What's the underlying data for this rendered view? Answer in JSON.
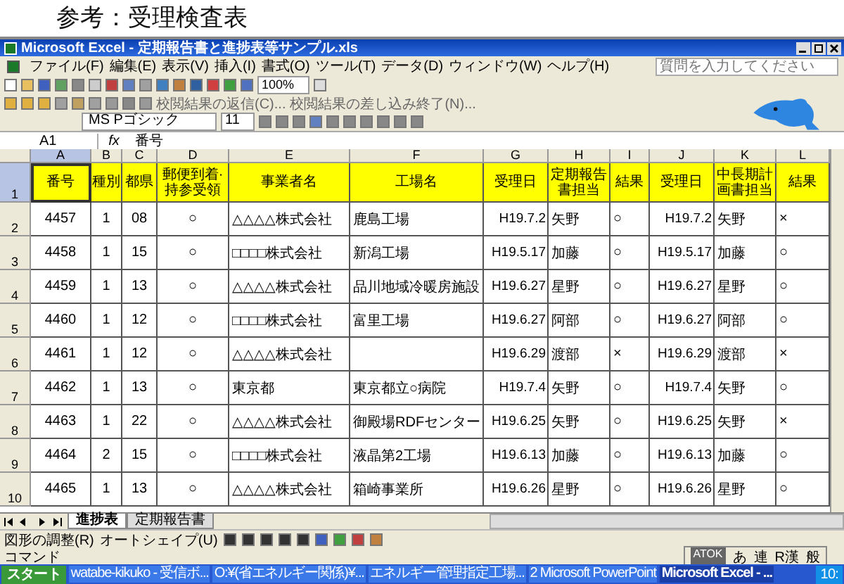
{
  "slide_title": "参考：受理検査表",
  "window": {
    "title": "Microsoft Excel - 定期報告書と進捗表等サンプル.xls"
  },
  "menu": [
    "ファイル(F)",
    "編集(E)",
    "表示(V)",
    "挿入(I)",
    "書式(O)",
    "ツール(T)",
    "データ(D)",
    "ウィンドウ(W)",
    "ヘルプ(H)"
  ],
  "help_search": {
    "placeholder": "質問を入力してください"
  },
  "standard_toolbar": {
    "zoom": "100%"
  },
  "review_toolbar": [
    "校閲結果の返信(C)...",
    "校閲結果の差し込み終了(N)..."
  ],
  "format_toolbar": {
    "font": "MS Pゴシック",
    "size": "11"
  },
  "formula_bar": {
    "name_box": "A1",
    "fx": "fx",
    "value": "番号"
  },
  "columns": [
    {
      "label": "A",
      "selected": true
    },
    {
      "label": "B",
      "selected": false
    },
    {
      "label": "C",
      "selected": false
    },
    {
      "label": "D",
      "selected": false
    },
    {
      "label": "E",
      "selected": false
    },
    {
      "label": "F",
      "selected": false
    },
    {
      "label": "G",
      "selected": false
    },
    {
      "label": "H",
      "selected": false
    },
    {
      "label": "I",
      "selected": false
    },
    {
      "label": "J",
      "selected": false
    },
    {
      "label": "K",
      "selected": false
    },
    {
      "label": "L",
      "selected": false
    }
  ],
  "header_row": {
    "row": "1",
    "selected": true,
    "cells": [
      "番号",
      "種別",
      "都県",
      "郵便到着·持参受領",
      "事業者名",
      "工場名",
      "受理日",
      "定期報告書担当",
      "結果",
      "受理日",
      "中長期計画書担当",
      "結果"
    ]
  },
  "rows": [
    {
      "row": "2",
      "selected": false,
      "cells": [
        "4457",
        "1",
        "08",
        "○",
        "△△△△株式会社",
        "鹿島工場",
        "H19.7.2",
        "矢野",
        "○",
        "H19.7.2",
        "矢野",
        "×"
      ]
    },
    {
      "row": "3",
      "selected": false,
      "cells": [
        "4458",
        "1",
        "15",
        "○",
        "□□□□株式会社",
        "新潟工場",
        "H19.5.17",
        "加藤",
        "○",
        "H19.5.17",
        "加藤",
        "○"
      ]
    },
    {
      "row": "4",
      "selected": false,
      "cells": [
        "4459",
        "1",
        "13",
        "○",
        "△△△△株式会社",
        "品川地域冷暖房施設",
        "H19.6.27",
        "星野",
        "○",
        "H19.6.27",
        "星野",
        "○"
      ]
    },
    {
      "row": "5",
      "selected": false,
      "cells": [
        "4460",
        "1",
        "12",
        "○",
        "□□□□株式会社",
        "富里工場",
        "H19.6.27",
        "阿部",
        "○",
        "H19.6.27",
        "阿部",
        "○"
      ]
    },
    {
      "row": "6",
      "selected": false,
      "cells": [
        "4461",
        "1",
        "12",
        "○",
        "△△△△株式会社",
        "",
        "H19.6.29",
        "渡部",
        "×",
        "H19.6.29",
        "渡部",
        "×"
      ]
    },
    {
      "row": "7",
      "selected": false,
      "cells": [
        "4462",
        "1",
        "13",
        "○",
        "東京都",
        "東京都立○病院",
        "H19.7.4",
        "矢野",
        "○",
        "H19.7.4",
        "矢野",
        "○"
      ]
    },
    {
      "row": "8",
      "selected": false,
      "cells": [
        "4463",
        "1",
        "22",
        "○",
        "△△△△株式会社",
        "御殿場RDFセンター",
        "H19.6.25",
        "矢野",
        "○",
        "H19.6.25",
        "矢野",
        "×"
      ]
    },
    {
      "row": "9",
      "selected": false,
      "cells": [
        "4464",
        "2",
        "15",
        "○",
        "□□□□株式会社",
        "液晶第2工場",
        "H19.6.13",
        "加藤",
        "○",
        "H19.6.13",
        "加藤",
        "○"
      ]
    },
    {
      "row": "10",
      "selected": false,
      "cells": [
        "4465",
        "1",
        "13",
        "○",
        "△△△△株式会社",
        "箱崎事業所",
        "H19.6.26",
        "星野",
        "○",
        "H19.6.26",
        "星野",
        "○"
      ]
    }
  ],
  "sheet_tabs": [
    {
      "label": "進捗表",
      "selected": true
    },
    {
      "label": "定期報告書",
      "selected": false
    }
  ],
  "drawing_toolbar": [
    "図形の調整(R)",
    "オートシェイプ(U)"
  ],
  "status_bar": "コマンド",
  "ime_bar": [
    "ATOK",
    "あ",
    "連",
    "R漢",
    "般"
  ],
  "taskbar": {
    "start": "スタート",
    "items": [
      {
        "label": "watabe-kikuko - 受信ボ...",
        "selected": false
      },
      {
        "label": "O:¥(省エネルギー関係)¥...",
        "selected": false
      },
      {
        "label": "エネルギー管理指定工場...",
        "selected": false
      },
      {
        "label": "2 Microsoft PowerPoint",
        "selected": false
      },
      {
        "label": "Microsoft Excel - ...",
        "selected": true
      }
    ],
    "clock": "10:"
  }
}
